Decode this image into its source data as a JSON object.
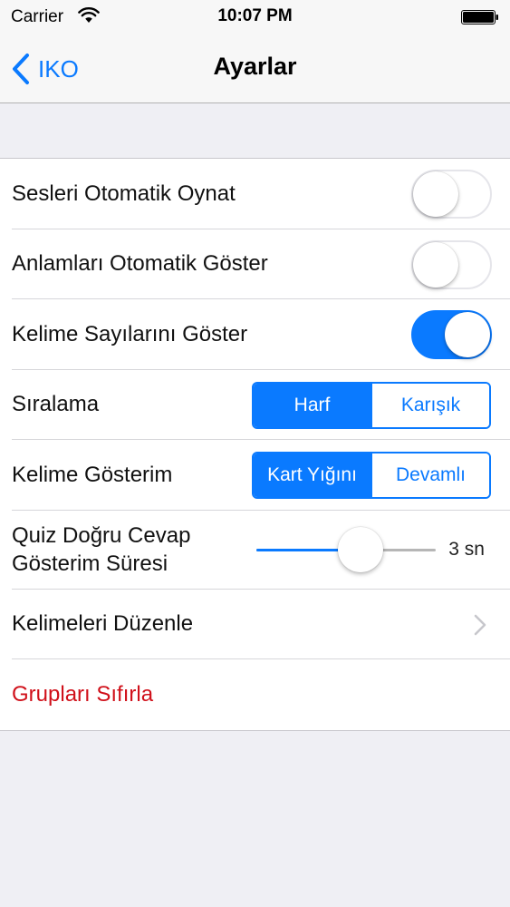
{
  "status_bar": {
    "carrier": "Carrier",
    "time": "10:07 PM",
    "icons": [
      "wifi-icon",
      "battery-icon"
    ]
  },
  "nav": {
    "back_label": "IKO",
    "title": "Ayarlar",
    "back_icon": "chevron-left-icon"
  },
  "settings": {
    "autoplay_sounds": {
      "label": "Sesleri Otomatik Oynat",
      "on": false
    },
    "auto_show_meanings": {
      "label": "Anlamları Otomatik Göster",
      "on": false
    },
    "show_word_counts": {
      "label": "Kelime Sayılarını Göster",
      "on": true
    },
    "ordering": {
      "label": "Sıralama",
      "options": [
        "Harf",
        "Karışık"
      ],
      "selected": 0
    },
    "word_display": {
      "label": "Kelime Gösterim",
      "options": [
        "Kart Yığını",
        "Devamlı"
      ],
      "selected": 0
    },
    "quiz_answer_duration": {
      "label_line1": "Quiz Doğru Cevap",
      "label_line2": "Gösterim Süresi",
      "value_text": "3 sn",
      "fraction": 0.58
    },
    "edit_words": {
      "label": "Kelimeleri Düzenle",
      "icon": "chevron-right-icon"
    },
    "reset_groups": {
      "label": "Grupları Sıfırla"
    }
  },
  "colors": {
    "accent": "#0a7aff",
    "destructive": "#d0101a",
    "background": "#efeff4",
    "bar": "#f7f7f7"
  }
}
